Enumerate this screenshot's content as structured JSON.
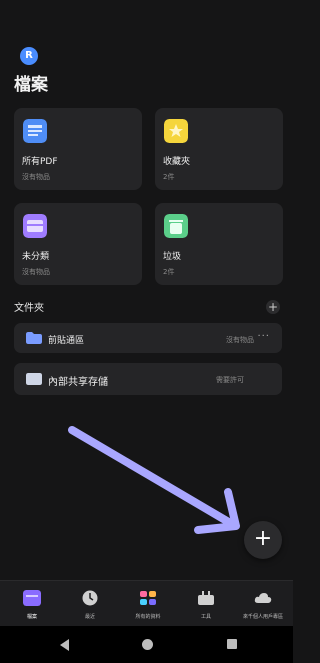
{
  "header": {
    "avatar_initial": "R",
    "title": "檔案"
  },
  "cards": [
    {
      "name": "所有PDF",
      "sub": "沒有物品",
      "icon": "pdf-doc-icon"
    },
    {
      "name": "收藏夾",
      "sub": "2件",
      "icon": "favorites-icon"
    },
    {
      "name": "未分類",
      "sub": "沒有物品",
      "icon": "uncategorized-icon"
    },
    {
      "name": "垃圾",
      "sub": "2件",
      "icon": "trash-icon"
    }
  ],
  "folders": {
    "title": "文件夾",
    "items": [
      {
        "label": "前貼通區",
        "status": "沒有物品"
      }
    ]
  },
  "storage": {
    "label": "內部共享存儲",
    "status": "需要許可"
  },
  "nav": [
    {
      "label": "檔案",
      "icon": "files-icon"
    },
    {
      "label": "最近",
      "icon": "clock-icon"
    },
    {
      "label": "所有的資料",
      "icon": "apps-icon"
    },
    {
      "label": "工具",
      "icon": "tools-icon"
    },
    {
      "label": "來千個人用戶專區",
      "icon": "cloud-icon"
    }
  ],
  "colors": {
    "accent": "#8a6cff",
    "background": "#151516",
    "card": "#252527"
  }
}
